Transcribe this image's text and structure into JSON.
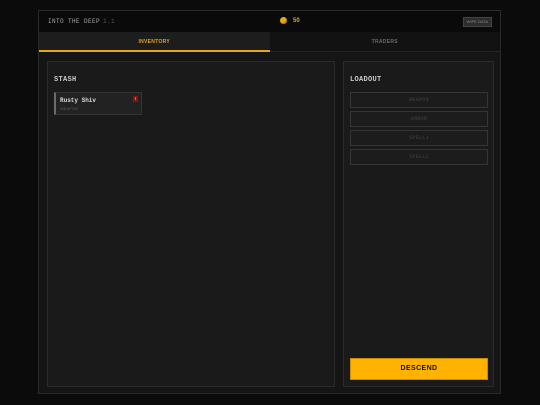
{
  "header": {
    "title": "INTO THE DEEP",
    "version": "1.1",
    "gold": "50",
    "wipe_label": "WIPE DATA"
  },
  "tabs": [
    {
      "label": "INVENTORY",
      "active": true
    },
    {
      "label": "TRADERS",
      "active": false
    }
  ],
  "stash": {
    "title": "STASH",
    "items": [
      {
        "name": "Rusty Shiv",
        "type": "WEAPON",
        "badge": "!"
      }
    ]
  },
  "loadout": {
    "title": "LOADOUT",
    "slots": [
      "WEAPON",
      "ARMOR",
      "SPELL1",
      "SPELL2"
    ],
    "descend_label": "DESCEND"
  },
  "colors": {
    "accent": "#e5a813",
    "button": "#ffb300",
    "badge": "#8a1212",
    "background": "#151515"
  }
}
